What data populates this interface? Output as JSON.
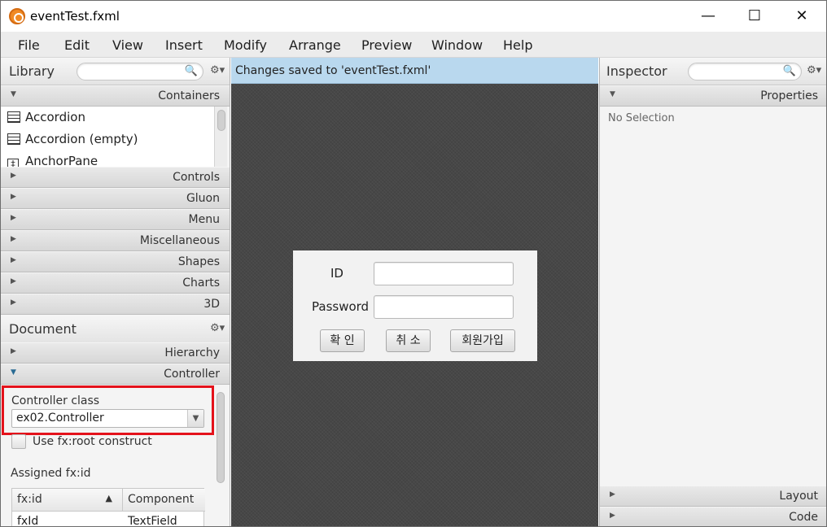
{
  "window": {
    "title": "eventTest.fxml",
    "minimize_glyph": "—",
    "maximize_glyph": "☐",
    "close_glyph": "✕"
  },
  "menubar": {
    "items": [
      "File",
      "Edit",
      "View",
      "Insert",
      "Modify",
      "Arrange",
      "Preview",
      "Window",
      "Help"
    ]
  },
  "library": {
    "title": "Library",
    "search_icon": "🔍",
    "gear_icon": "⚙▾",
    "containers_label": "Containers",
    "items": [
      {
        "label": "Accordion",
        "icon": "accordion-icon"
      },
      {
        "label": "Accordion  (empty)",
        "icon": "accordion-icon"
      },
      {
        "label": "AnchorPane",
        "icon": "anchorpane-icon",
        "glyph": "‡"
      }
    ],
    "sections": [
      "Controls",
      "Gluon",
      "Menu",
      "Miscellaneous",
      "Shapes",
      "Charts",
      "3D"
    ]
  },
  "document": {
    "title": "Document",
    "gear_icon": "⚙▾",
    "sections": [
      "Hierarchy",
      "Controller"
    ],
    "controller_class_label": "Controller class",
    "controller_class_value": "ex02.Controller",
    "dropdown_arrow": "▼",
    "fxroot_label": "Use fx:root construct",
    "assigned_label": "Assigned fx:id",
    "table": {
      "headers": [
        "fx:id",
        "Component"
      ],
      "sort_arrow": "▲",
      "rows": [
        [
          "fxId",
          "TextField"
        ]
      ]
    }
  },
  "center": {
    "status_message": "Changes saved to 'eventTest.fxml'",
    "form": {
      "id_label": "ID",
      "password_label": "Password",
      "buttons": [
        "확 인",
        "취 소",
        "회원가입"
      ]
    }
  },
  "inspector": {
    "title": "Inspector",
    "search_icon": "🔍",
    "gear_icon": "⚙▾",
    "properties_label": "Properties",
    "no_selection": "No Selection",
    "bottom_sections": [
      "Layout",
      "Code"
    ]
  },
  "arrows": {
    "collapsed": "▶",
    "expanded": "▼"
  }
}
